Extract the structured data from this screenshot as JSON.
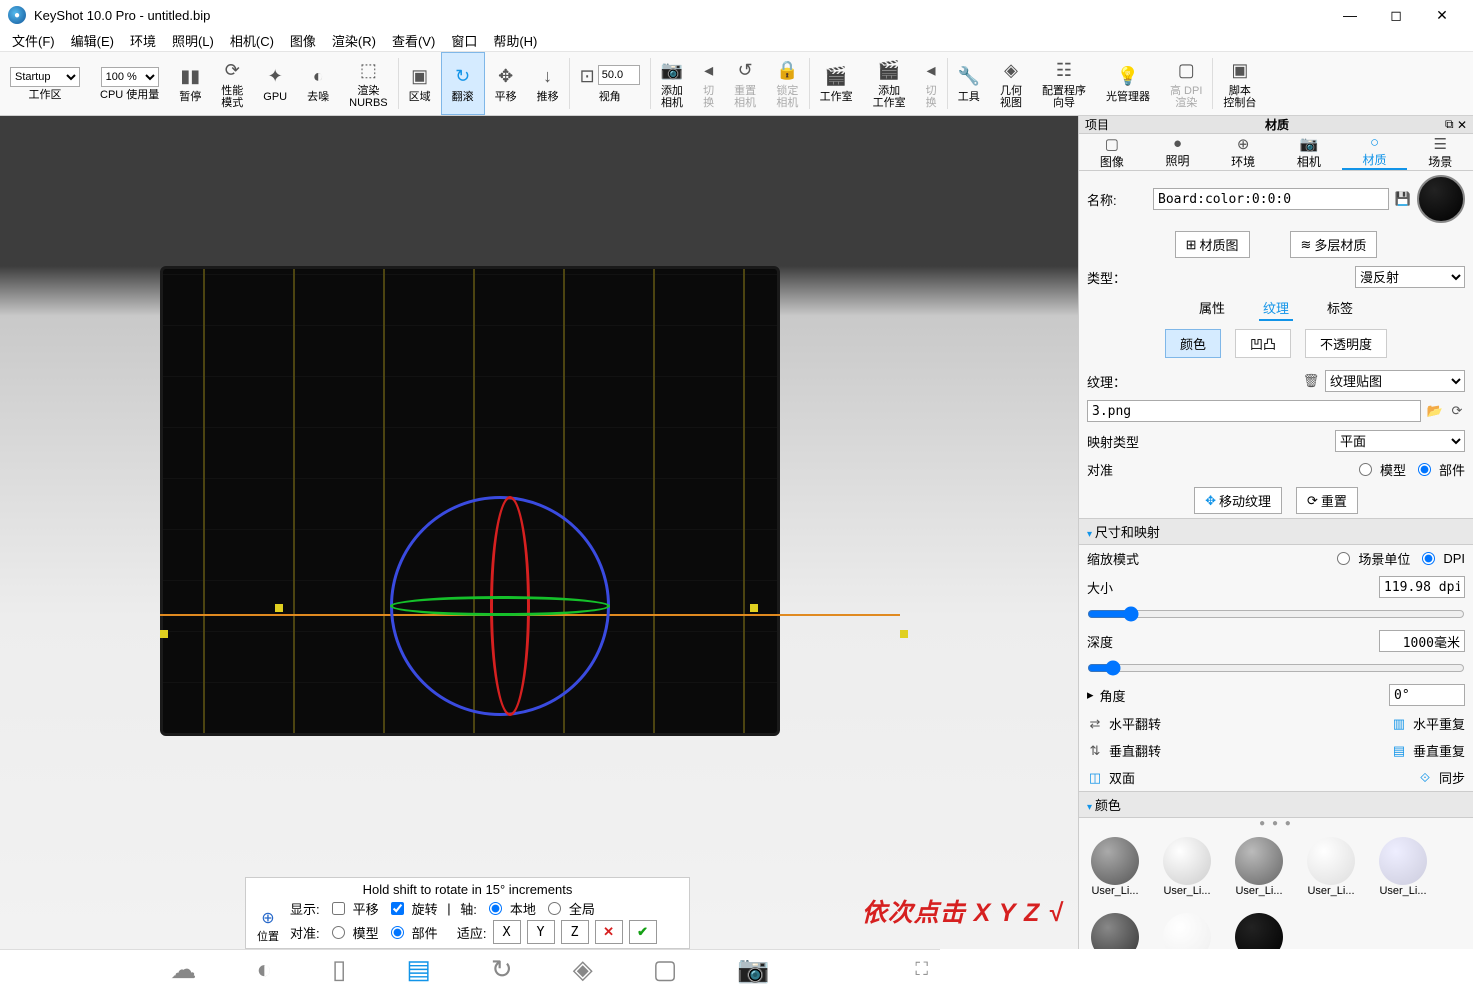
{
  "title": "KeyShot 10.0 Pro  - untitled.bip",
  "menu": [
    "文件(F)",
    "编辑(E)",
    "环境",
    "照明(L)",
    "相机(C)",
    "图像",
    "渲染(R)",
    "查看(V)",
    "窗口",
    "帮助(H)"
  ],
  "toolbar": {
    "workspace_sel": "Startup",
    "zoom": "100 %",
    "items": [
      {
        "l": "工作区"
      },
      {
        "l": "CPU 使用量"
      },
      {
        "l": "暂停",
        "i": "⏸"
      },
      {
        "l": "性能\n模式",
        "i": "⟳"
      },
      {
        "l": "GPU",
        "i": "✦"
      },
      {
        "l": "去噪",
        "i": "◐"
      },
      {
        "l": "渲染\nNURBS",
        "i": "⬚"
      },
      {
        "l": "区域",
        "i": "▣"
      },
      {
        "l": "翻滚",
        "i": "↻",
        "active": true
      },
      {
        "l": "平移",
        "i": "✥"
      },
      {
        "l": "推移",
        "i": "↓"
      },
      {
        "l": "视角",
        "i": "⊡",
        "val": "50.0"
      },
      {
        "l": "添加\n相机",
        "i": "⊕"
      },
      {
        "l": "切\n换",
        "i": "◂",
        "dis": true
      },
      {
        "l": "重置\n相机",
        "i": "↺",
        "dis": true
      },
      {
        "l": "锁定\n相机",
        "i": "🔒",
        "dis": true
      },
      {
        "l": "工作室",
        "i": "🎬"
      },
      {
        "l": "添加\n工作室",
        "i": "🎬"
      },
      {
        "l": "切\n换",
        "i": "◂",
        "dis": true
      },
      {
        "l": "工具",
        "i": "🔧"
      },
      {
        "l": "几何\n视图",
        "i": "◈"
      },
      {
        "l": "配置程序\n向导",
        "i": "☷"
      },
      {
        "l": "光管理器",
        "i": "💡"
      },
      {
        "l": "高 DPI\n渲染",
        "i": "▢",
        "dis": true
      },
      {
        "l": "脚本\n控制台",
        "i": "▣"
      }
    ]
  },
  "hint": {
    "top": "Hold shift to rotate in 15° increments",
    "pos": "位置",
    "show": "显示:",
    "pan": "平移",
    "rot": "旋转",
    "axis": "轴:",
    "local": "本地",
    "global": "全局",
    "align": "对准:",
    "model": "模型",
    "part": "部件",
    "fit": "适应:",
    "X": "X",
    "Y": "Y",
    "Z": "Z"
  },
  "annot": "依次点击 X Y Z √",
  "panel": {
    "proj": "项目",
    "title": "材质",
    "tabs": [
      {
        "l": "图像",
        "i": "▢"
      },
      {
        "l": "照明",
        "i": "💡"
      },
      {
        "l": "环境",
        "i": "⊕"
      },
      {
        "l": "相机",
        "i": "📷"
      },
      {
        "l": "材质",
        "i": "○",
        "active": true
      },
      {
        "l": "场景",
        "i": "☰"
      }
    ],
    "name_lbl": "名称:",
    "name_val": "Board:color:0:0:0",
    "matgraph": "材质图",
    "multilayer": "多层材质",
    "type_lbl": "类型：",
    "type_val": "漫反射",
    "subtabs": [
      "属性",
      "纹理",
      "标签"
    ],
    "subtabs_active": 1,
    "chan": [
      "颜色",
      "凹凸",
      "不透明度"
    ],
    "chan_active": 0,
    "tex_lbl": "纹理：",
    "tex_sel": "纹理贴图",
    "tex_file": "3.png",
    "map_lbl": "映射类型",
    "map_val": "平面",
    "align_lbl": "对准",
    "align_model": "模型",
    "align_part": "部件",
    "move_tex": "移动纹理",
    "reset": "重置",
    "sect_size": "尺寸和映射",
    "scale_lbl": "缩放模式",
    "scale_scene": "场景单位",
    "scale_dpi": "DPI",
    "size_lbl": "大小",
    "size_val": "119.98 dpi",
    "depth_lbl": "深度",
    "depth_val": "1000毫米",
    "angle_lbl": "角度",
    "angle_val": "0°",
    "hflip": "水平翻转",
    "hrepeat": "水平重复",
    "vflip": "垂直翻转",
    "vrepeat": "垂直重复",
    "twoside": "双面",
    "sync": "同步",
    "sect_color": "颜色",
    "mats": [
      "User_Li...",
      "User_Li...",
      "User_Li...",
      "User_Li...",
      "User_Li..."
    ]
  }
}
